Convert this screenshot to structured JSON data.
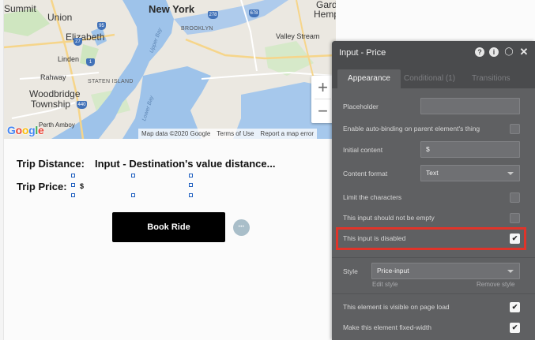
{
  "map": {
    "labels": {
      "summit": "Summit",
      "union": "Union",
      "new_york": "New York",
      "hemp": "Hemp",
      "garden": "Garden",
      "elizabeth": "Elizabeth",
      "brooklyn": "BROOKLYN",
      "valley_stream": "Valley Stream",
      "linden": "Linden",
      "rahway": "Rahway",
      "staten_island": "STATEN ISLAND",
      "woodbridge": "Woodbridge",
      "township": "Township",
      "perth_amboy": "Perth Amboy",
      "upper_bay": "Upper Bay",
      "lower_bay": "Lower Bay"
    },
    "shields": {
      "s1": "95",
      "s2": "678",
      "s3": "278",
      "s4": "1",
      "s5": "27",
      "s6": "440"
    },
    "zoom_in": "+",
    "zoom_out": "−",
    "logo": [
      "G",
      "o",
      "o",
      "g",
      "l",
      "e"
    ],
    "footer": {
      "map_data": "Map data ©2020 Google",
      "terms": "Terms of Use",
      "report": "Report a map error"
    }
  },
  "page": {
    "trip_distance_label": "Trip Distance:",
    "distance_value": "Input - Destination's value distance...",
    "trip_price_label": "Trip Price:",
    "price_value": "$",
    "book_ride_label": "Book Ride",
    "dot_text": "•••"
  },
  "editor": {
    "title": "Input - Price",
    "icons": {
      "help": "?",
      "info": "i",
      "comment": "◯",
      "close": "✕"
    },
    "tabs": {
      "appearance": "Appearance",
      "conditional": "Conditional (1)",
      "transitions": "Transitions"
    },
    "rows": {
      "placeholder": "Placeholder",
      "auto_binding": "Enable auto-binding on parent element's thing",
      "initial_content": "Initial content",
      "initial_content_value": "$",
      "content_format": "Content format",
      "content_format_value": "Text",
      "limit_chars": "Limit the characters",
      "not_empty": "This input should not be empty",
      "disabled": "This input is disabled",
      "style": "Style",
      "style_value": "Price-input",
      "edit_style": "Edit style",
      "remove_style": "Remove style",
      "visible_on_load": "This element is visible on page load",
      "fixed_width": "Make this element fixed-width"
    },
    "checks": {
      "auto_binding": false,
      "limit_chars": false,
      "not_empty": false,
      "disabled": true,
      "visible_on_load": true,
      "fixed_width": true
    },
    "check_glyph": "✔"
  }
}
